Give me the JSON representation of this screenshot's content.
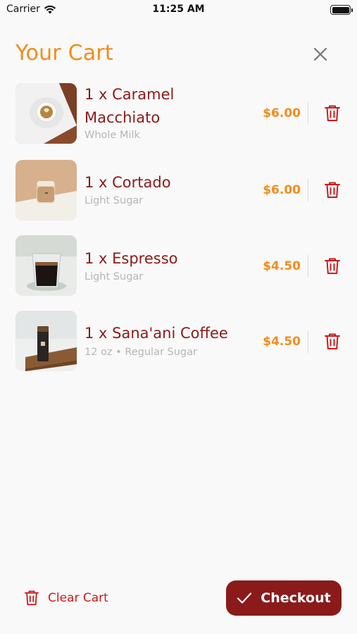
{
  "status_bar": {
    "carrier": "Carrier",
    "time": "11:25 AM"
  },
  "header": {
    "title": "Your Cart",
    "close_icon": "close-icon"
  },
  "cart": {
    "items": [
      {
        "name_line1": "1 x Caramel",
        "name_line2": "Macchiato",
        "option": "Whole Milk",
        "price": "$6.00",
        "image": "caramel-macchiato-image"
      },
      {
        "name_line1": "1 x Cortado",
        "option": "Light Sugar",
        "price": "$6.00",
        "image": "cortado-image"
      },
      {
        "name_line1": "1 x Espresso",
        "option": "Light Sugar",
        "price": "$4.50",
        "image": "espresso-image"
      },
      {
        "name_line1": "1 x Sana'ani Coffee",
        "option": "12 oz • Regular Sugar",
        "price": "$4.50",
        "image": "sanaani-coffee-image"
      }
    ]
  },
  "footer": {
    "clear_cart_label": "Clear Cart",
    "checkout_label": "Checkout"
  },
  "colors": {
    "accent": "#f28c1b",
    "brand": "#8b1a1a",
    "danger": "#c71c1c",
    "muted": "#b5b5b5",
    "background": "#f9f9f9"
  }
}
